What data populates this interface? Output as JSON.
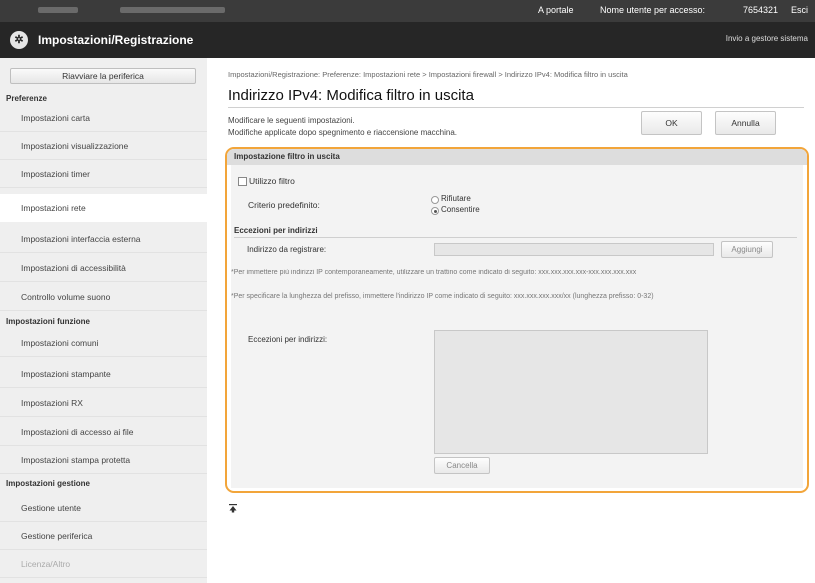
{
  "topbar": {
    "portal_link": "A portale",
    "user_label": "Nome utente per accesso:",
    "user_id": "7654321",
    "logout_link": "Esci"
  },
  "header": {
    "title": "Impostazioni/Registrazione",
    "send_admin_link": "Invio a gestore sistema",
    "logo_icon": "brand-globe-icon"
  },
  "sidebar": {
    "restart_button": "Riavviare la periferica",
    "sections": [
      {
        "title": "Preferenze",
        "items": [
          {
            "label": "Impostazioni carta",
            "active": false
          },
          {
            "label": "Impostazioni visualizzazione",
            "active": false
          },
          {
            "label": "Impostazioni timer",
            "active": false
          },
          {
            "label": "Impostazioni rete",
            "active": true
          },
          {
            "label": "Impostazioni interfaccia esterna",
            "active": false
          },
          {
            "label": "Impostazioni di accessibilità",
            "active": false
          },
          {
            "label": "Controllo volume suono",
            "active": false
          }
        ]
      },
      {
        "title": "Impostazioni funzione",
        "items": [
          {
            "label": "Impostazioni comuni",
            "active": false
          },
          {
            "label": "Impostazioni stampante",
            "active": false
          },
          {
            "label": "Impostazioni RX",
            "active": false
          },
          {
            "label": "Impostazioni di accesso ai file",
            "active": false
          },
          {
            "label": "Impostazioni stampa protetta",
            "active": false
          }
        ]
      },
      {
        "title": "Impostazioni gestione",
        "items": [
          {
            "label": "Gestione utente",
            "active": false
          },
          {
            "label": "Gestione periferica",
            "active": false
          },
          {
            "label": "Licenza/Altro",
            "active": false
          }
        ]
      }
    ]
  },
  "main": {
    "breadcrumb": "Impostazioni/Registrazione: Preferenze: Impostazioni rete > Impostazioni firewall > Indirizzo IPv4: Modifica filtro in uscita",
    "page_title": "Indirizzo IPv4: Modifica filtro in uscita",
    "description_line1": "Modificare le seguenti impostazioni.",
    "description_line2": "Modifiche applicate dopo spegnimento e riaccensione macchina.",
    "ok_button": "OK",
    "cancel_button": "Annulla",
    "panel": {
      "header": "Impostazione filtro in uscita",
      "use_filter_label": "Utilizzo filtro",
      "use_filter_checked": false,
      "default_policy_label": "Criterio predefinito:",
      "policy_options": [
        {
          "label": "Rifiutare",
          "selected": false
        },
        {
          "label": "Consentire",
          "selected": true
        }
      ],
      "exceptions_section": "Eccezioni per indirizzi",
      "address_to_register_label": "Indirizzo da registrare:",
      "address_value": "",
      "add_button": "Aggiungi",
      "note1": "*Per immettere più indirizzi IP contemporaneamente, utilizzare un trattino come indicato di seguito: xxx.xxx.xxx.xxx-xxx.xxx.xxx.xxx",
      "note2": "*Per specificare la lunghezza del prefisso, immettere l'indirizzo IP come indicato di seguito: xxx.xxx.xxx.xxx/xx (lunghezza prefisso: 0-32)",
      "exceptions_list_label": "Eccezioni per indirizzi:",
      "delete_button": "Cancella",
      "accent_color": "#f2a53a"
    },
    "back_to_top_icon": "back-to-top-icon"
  }
}
